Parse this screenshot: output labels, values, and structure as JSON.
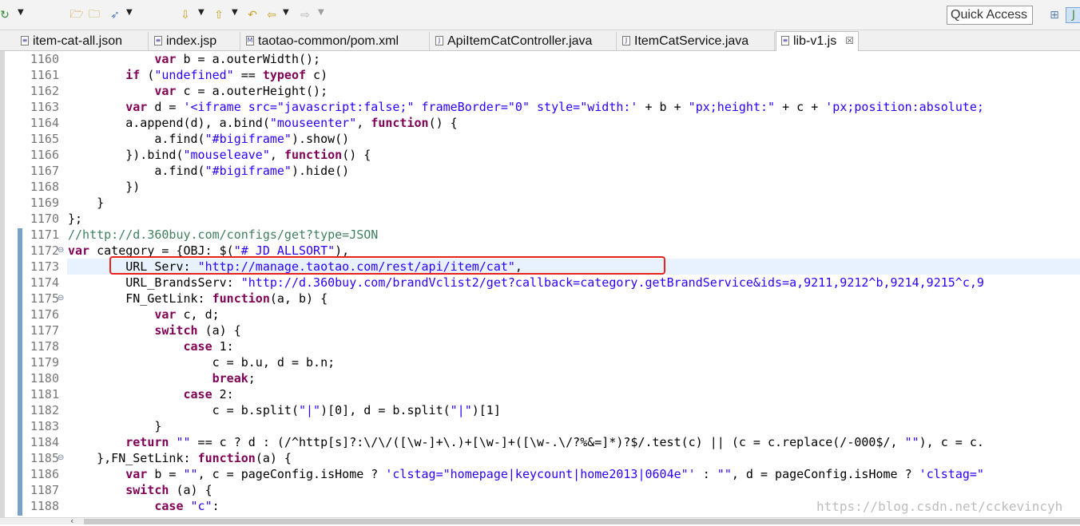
{
  "toolbar": {
    "quick_access": "Quick Access",
    "icons": [
      "refresh-icon",
      "open-folder-icon",
      "open-project-icon",
      "run-icon",
      "next-annotation-icon",
      "prev-annotation-icon",
      "last-edit-icon",
      "back-icon",
      "forward-icon",
      "open-perspective-icon",
      "java-perspective-icon"
    ]
  },
  "tabs": [
    {
      "label": "item-cat-all.json",
      "icon": "json-file-icon",
      "active": false
    },
    {
      "label": "index.jsp",
      "icon": "jsp-file-icon",
      "active": false
    },
    {
      "label": "taotao-common/pom.xml",
      "icon": "maven-file-icon",
      "active": false
    },
    {
      "label": "ApiItemCatController.java",
      "icon": "java-file-icon",
      "active": false
    },
    {
      "label": "ItemCatService.java",
      "icon": "java-file-icon",
      "active": false
    },
    {
      "label": "lib-v1.js",
      "icon": "js-file-icon",
      "active": true,
      "close": "☒"
    }
  ],
  "editor": {
    "lines": [
      {
        "num": "1160",
        "text": "            var b = a.outerWidth();"
      },
      {
        "num": "1161",
        "text": "        if (\"undefined\" == typeof c)"
      },
      {
        "num": "1162",
        "text": "            var c = a.outerHeight();"
      },
      {
        "num": "1163",
        "text": "        var d = '<iframe src=\"javascript:false;\" frameBorder=\"0\" style=\"width:' + b + \"px;height:\" + c + 'px;position:absolute;"
      },
      {
        "num": "1164",
        "text": "        a.append(d), a.bind(\"mouseenter\", function() {"
      },
      {
        "num": "1165",
        "text": "            a.find(\"#bigiframe\").show()"
      },
      {
        "num": "1166",
        "text": "        }).bind(\"mouseleave\", function() {"
      },
      {
        "num": "1167",
        "text": "            a.find(\"#bigiframe\").hide()"
      },
      {
        "num": "1168",
        "text": "        })"
      },
      {
        "num": "1169",
        "text": "    }"
      },
      {
        "num": "1170",
        "text": "};"
      },
      {
        "num": "1171",
        "text": "//http://d.360buy.com/configs/get?type=JSON"
      },
      {
        "num": "1172",
        "text": "var category = {OBJ: $(\"#_JD_ALLSORT\"),",
        "fold": true
      },
      {
        "num": "1173",
        "text": "        URL_Serv: \"http://manage.taotao.com/rest/api/item/cat\",",
        "current": true
      },
      {
        "num": "1174",
        "text": "        URL_BrandsServ: \"http://d.360buy.com/brandVclist2/get?callback=category.getBrandService&ids=a,9211,9212^b,9214,9215^c,9"
      },
      {
        "num": "1175",
        "text": "        FN_GetLink: function(a, b) {",
        "fold": true
      },
      {
        "num": "1176",
        "text": "            var c, d;"
      },
      {
        "num": "1177",
        "text": "            switch (a) {"
      },
      {
        "num": "1178",
        "text": "                case 1:"
      },
      {
        "num": "1179",
        "text": "                    c = b.u, d = b.n;"
      },
      {
        "num": "1180",
        "text": "                    break;"
      },
      {
        "num": "1181",
        "text": "                case 2:"
      },
      {
        "num": "1182",
        "text": "                    c = b.split(\"|\")[0], d = b.split(\"|\")[1]"
      },
      {
        "num": "1183",
        "text": "            }"
      },
      {
        "num": "1184",
        "text": "        return \"\" == c ? d : (/^http[s]?:\\/\\/([\\w-]+\\.)+[\\w-]+([\\w-.\\/?%&=]*)?$/.test(c) || (c = c.replace(/-000$/, \"\"), c = c."
      },
      {
        "num": "1185",
        "text": "    },FN_SetLink: function(a) {",
        "fold": true
      },
      {
        "num": "1186",
        "text": "        var b = \"\", c = pageConfig.isHome ? 'clstag=\"homepage|keycount|home2013|0604e\"' : \"\", d = pageConfig.isHome ? 'clstag=\""
      },
      {
        "num": "1187",
        "text": "        switch (a) {"
      },
      {
        "num": "1188",
        "text": "            case \"c\":"
      }
    ]
  },
  "watermark": "https://blog.csdn.net/cckevincyh",
  "colors": {
    "keyword": "#7f0055",
    "string": "#2a00ff",
    "comment": "#3f7f5f",
    "highlight_box": "#e8221e",
    "current_line": "#e8f2fe"
  }
}
